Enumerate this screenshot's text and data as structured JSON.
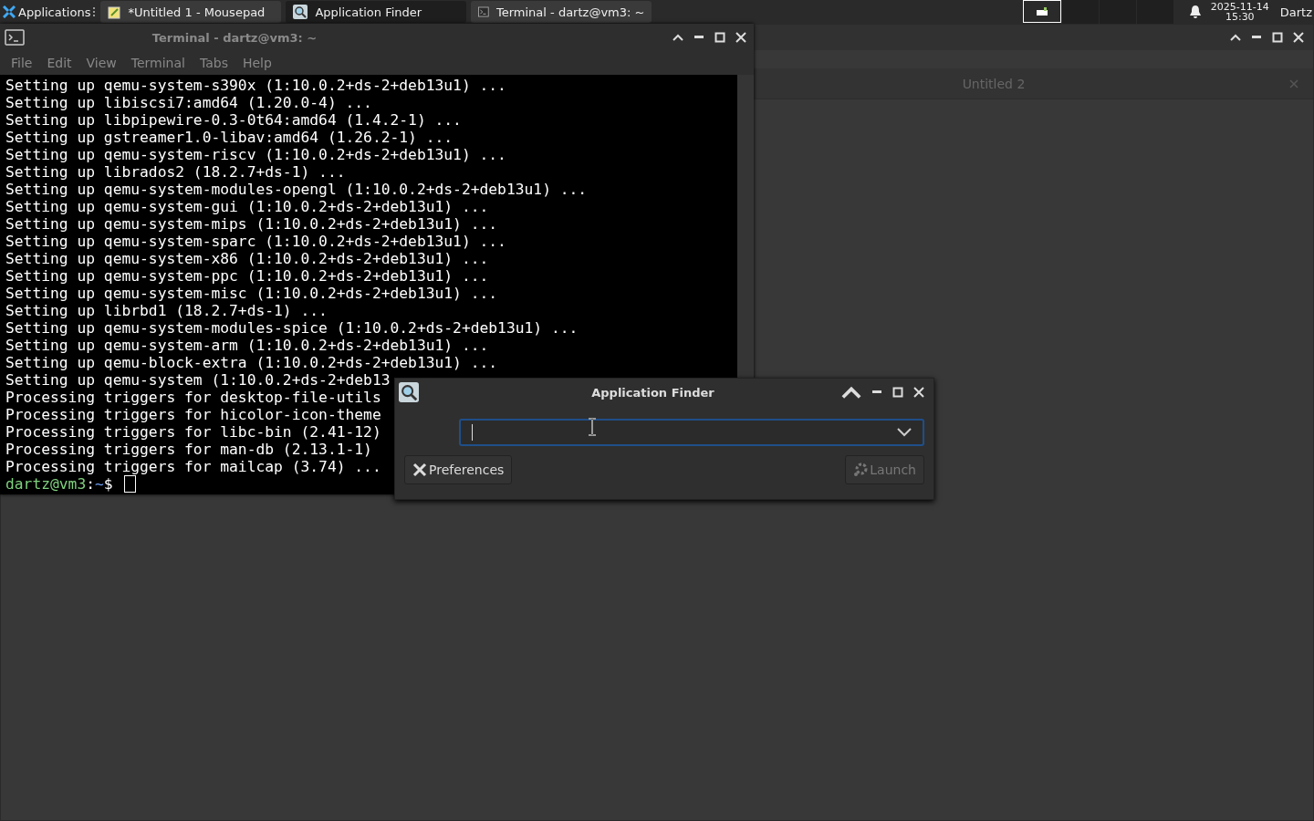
{
  "taskbar": {
    "menu": "Applications",
    "tasks": [
      {
        "title": "*Untitled 1 - Mousepad",
        "selected": false
      },
      {
        "title": "Application Finder",
        "selected": true
      },
      {
        "title": "Terminal - dartz@vm3: ~",
        "selected": false
      }
    ],
    "workspaces": [
      {
        "selected": true
      },
      {
        "selected": false
      },
      {
        "selected": false
      },
      {
        "selected": false
      }
    ],
    "clock": {
      "date": "2025-11-14",
      "time": "15:30"
    },
    "user": "Dartz"
  },
  "editor_window": {
    "tab": "Untitled 2"
  },
  "terminal_window": {
    "title": "Terminal - dartz@vm3: ~",
    "menu": [
      "File",
      "Edit",
      "View",
      "Terminal",
      "Tabs",
      "Help"
    ],
    "lines": [
      "Setting up qemu-system-s390x (1:10.0.2+ds-2+deb13u1) ...",
      "Setting up libiscsi7:amd64 (1.20.0-4) ...",
      "Setting up libpipewire-0.3-0t64:amd64 (1.4.2-1) ...",
      "Setting up gstreamer1.0-libav:amd64 (1.26.2-1) ...",
      "Setting up qemu-system-riscv (1:10.0.2+ds-2+deb13u1) ...",
      "Setting up librados2 (18.2.7+ds-1) ...",
      "Setting up qemu-system-modules-opengl (1:10.0.2+ds-2+deb13u1) ...",
      "Setting up qemu-system-gui (1:10.0.2+ds-2+deb13u1) ...",
      "Setting up qemu-system-mips (1:10.0.2+ds-2+deb13u1) ...",
      "Setting up qemu-system-sparc (1:10.0.2+ds-2+deb13u1) ...",
      "Setting up qemu-system-x86 (1:10.0.2+ds-2+deb13u1) ...",
      "Setting up qemu-system-ppc (1:10.0.2+ds-2+deb13u1) ...",
      "Setting up qemu-system-misc (1:10.0.2+ds-2+deb13u1) ...",
      "Setting up librbd1 (18.2.7+ds-1) ...",
      "Setting up qemu-system-modules-spice (1:10.0.2+ds-2+deb13u1) ...",
      "Setting up qemu-system-arm (1:10.0.2+ds-2+deb13u1) ...",
      "Setting up qemu-block-extra (1:10.0.2+ds-2+deb13u1) ...",
      "Setting up qemu-system (1:10.0.2+ds-2+deb13",
      "Processing triggers for desktop-file-utils",
      "Processing triggers for hicolor-icon-theme",
      "Processing triggers for libc-bin (2.41-12)",
      "Processing triggers for man-db (2.13.1-1)",
      "Processing triggers for mailcap (3.74) ..."
    ],
    "prompt": [
      {
        "text": "dartz@vm3",
        "color": "#7fd17f"
      },
      {
        "text": ":",
        "color": "#ffffff"
      },
      {
        "text": "~",
        "color": "#6f9ff5"
      },
      {
        "text": "$",
        "color": "#ffffff"
      }
    ]
  },
  "finder_dialog": {
    "title": "Application Finder",
    "field": {
      "focused": true
    },
    "buttons": [
      {
        "label": "Preferences",
        "disabled": false
      },
      {
        "label": "Launch",
        "disabled": true
      }
    ]
  }
}
